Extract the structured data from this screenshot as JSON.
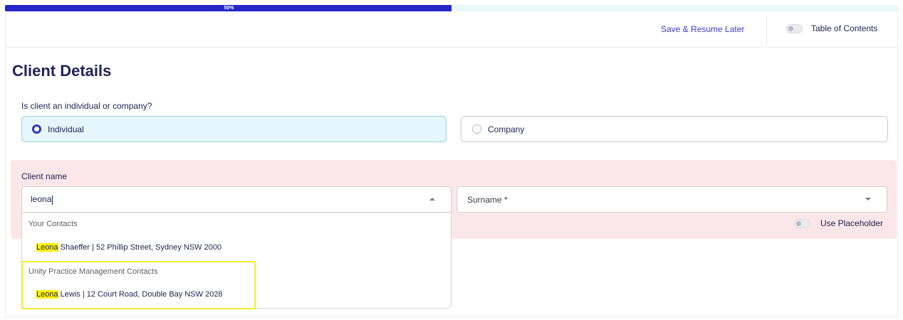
{
  "progress": {
    "percent": 50,
    "label": "50%",
    "color": "#2626c9"
  },
  "header": {
    "save_label": "Save & Resume Later",
    "toc_label": "Table of Contents",
    "toc_toggle_on": false
  },
  "page": {
    "title": "Client Details"
  },
  "client_type": {
    "question": "Is client an individual or company?",
    "options": [
      {
        "label": "Individual",
        "selected": true
      },
      {
        "label": "Company",
        "selected": false
      }
    ]
  },
  "client_name": {
    "label": "Client name",
    "first_name_value": "leona",
    "surname_placeholder": "Surname *",
    "use_placeholder_label": "Use Placeholder",
    "use_placeholder_on": false,
    "suggestion_groups": [
      {
        "header": "Your Contacts",
        "items": [
          {
            "match": "Leona",
            "rest": " Shaeffer | 52 Phillip Street, Sydney NSW 2000"
          }
        ]
      },
      {
        "header": "Unity Practice Management Contacts",
        "items": [
          {
            "match": "Leona",
            "rest": " Lewis | 12 Court Road, Double Bay NSW 2028"
          }
        ]
      }
    ]
  },
  "colors": {
    "accent": "#2626c9",
    "link": "#3b3bd1",
    "selected_option_bg": "#e6f6fd",
    "error_panel_bg": "#fbe7e9",
    "match_highlight": "#fff200",
    "annotation_box": "#f3ec2c"
  }
}
